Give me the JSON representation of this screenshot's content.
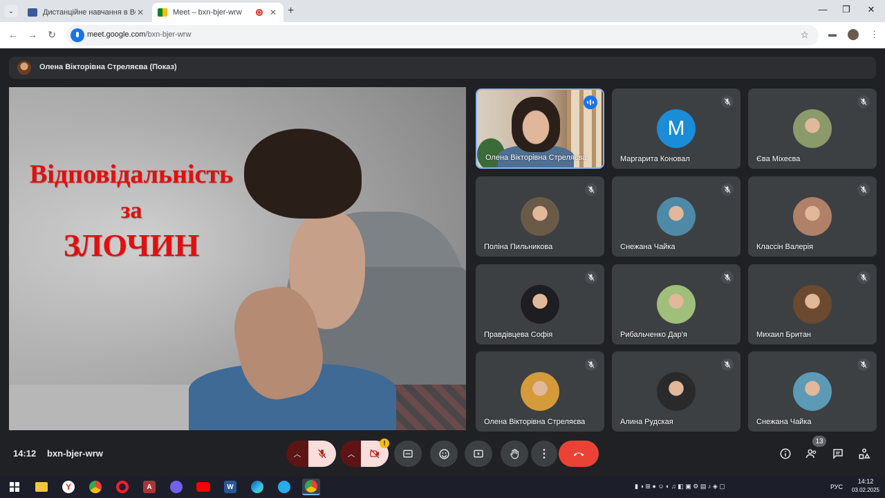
{
  "browser": {
    "tabs": [
      {
        "title": "Дистанційне навчання в ВСП",
        "active": false
      },
      {
        "title": "Meet – bxn-bjer-wrw",
        "active": true
      }
    ],
    "url_host": "meet.google.com",
    "url_path": "/bxn-bjer-wrw"
  },
  "meet": {
    "presenter_label": "Олена Вікторівна Стреляєва (Показ)",
    "slide": {
      "line1": "Відповідальність",
      "line2": "за",
      "line3": "ЗЛОЧИН"
    },
    "participants": [
      {
        "name": "Олена Вікторівна Стреляєва",
        "type": "video",
        "speaking": true
      },
      {
        "name": "Маргарита Коновал",
        "type": "letter",
        "letter": "M",
        "color": "#1a8cd8"
      },
      {
        "name": "Єва Міхеєва",
        "type": "photo",
        "color": "#8a9a6a"
      },
      {
        "name": "Поліна Пильникова",
        "type": "photo",
        "color": "#6a5a48"
      },
      {
        "name": "Снежана Чайка",
        "type": "photo",
        "color": "#4e8aa8"
      },
      {
        "name": "Классін Валерія",
        "type": "photo",
        "color": "#b08068"
      },
      {
        "name": "Правдівцева Софія",
        "type": "photo",
        "color": "#1e1e22"
      },
      {
        "name": "Рибальченко Дар'я",
        "type": "photo",
        "color": "#9fbf7a"
      },
      {
        "name": "Михаил Британ",
        "type": "photo",
        "color": "#6b4a30"
      },
      {
        "name": "Олена Вікторівна Стреляєва",
        "type": "photo",
        "color": "#d59a3a"
      },
      {
        "name": "Алина Рудская",
        "type": "photo",
        "color": "#2a2a2a"
      },
      {
        "name": "Снежана Чайка",
        "type": "photo",
        "color": "#5c9ab6"
      }
    ],
    "time": "14:12",
    "meeting_code": "bxn-bjer-wrw",
    "people_count": "13"
  },
  "taskbar": {
    "lang": "РУС",
    "time": "14:12",
    "date": "03.02.2025"
  },
  "colors": {
    "bg": "#202124",
    "tile": "#3c4043",
    "end_call": "#ea4335",
    "speaking_border": "#8ab4f8",
    "slide_text": "#e01010"
  }
}
